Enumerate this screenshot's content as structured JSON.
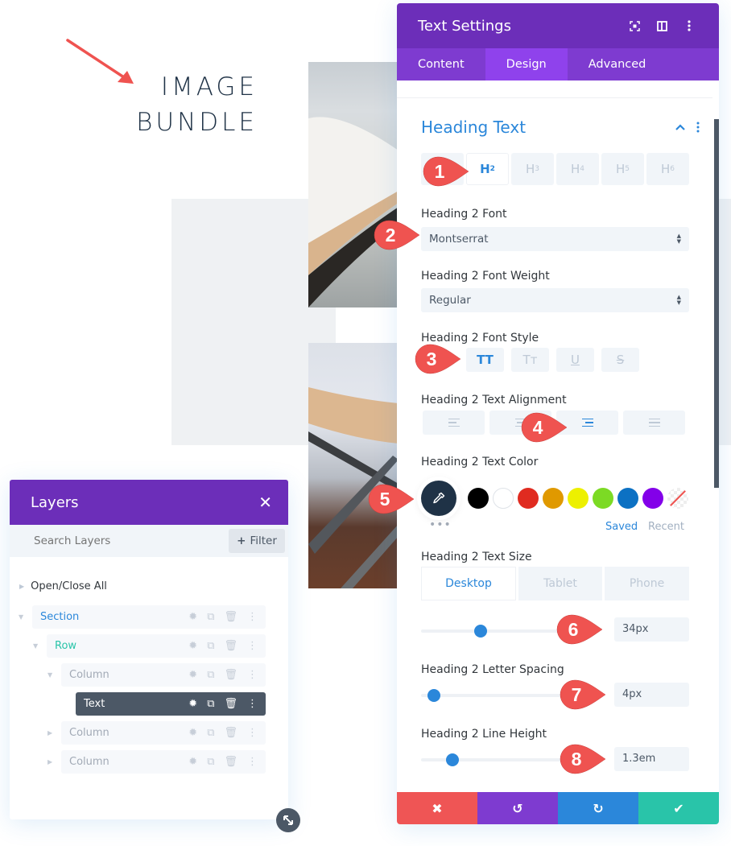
{
  "canvas": {
    "heading_line1": "IMAGE",
    "heading_line2": "BUNDLE"
  },
  "markers": [
    "1",
    "2",
    "3",
    "4",
    "5",
    "6",
    "7",
    "8"
  ],
  "settings": {
    "title": "Text Settings",
    "header_icons": [
      "fullscreen-icon",
      "split-view-icon",
      "more-vertical-icon"
    ],
    "tabs": [
      {
        "label": "Content",
        "active": false
      },
      {
        "label": "Design",
        "active": true
      },
      {
        "label": "Advanced",
        "active": false
      }
    ],
    "section_title": "Heading Text",
    "heading_tabs": [
      {
        "label": "H",
        "sub": "2",
        "active": true
      },
      {
        "label": "H",
        "sub": "3",
        "active": false
      },
      {
        "label": "H",
        "sub": "4",
        "active": false
      },
      {
        "label": "H",
        "sub": "5",
        "active": false
      },
      {
        "label": "H",
        "sub": "6",
        "active": false
      }
    ],
    "font": {
      "label": "Heading 2 Font",
      "value": "Montserrat"
    },
    "font_weight": {
      "label": "Heading 2 Font Weight",
      "value": "Regular"
    },
    "font_style": {
      "label": "Heading 2 Font Style",
      "buttons": [
        {
          "label": "TT",
          "name": "uppercase",
          "active": true
        },
        {
          "label": "Tт",
          "name": "capitalize",
          "active": false
        },
        {
          "label": "U",
          "name": "underline",
          "active": false
        },
        {
          "label": "S",
          "name": "strikethrough",
          "active": false
        }
      ]
    },
    "text_alignment": {
      "label": "Heading 2 Text Alignment",
      "options": [
        "left",
        "center",
        "right",
        "justify"
      ],
      "selected": "right"
    },
    "text_color": {
      "label": "Heading 2 Text Color",
      "current": "#1f3246",
      "swatches": [
        "#000000",
        "#ffffff",
        "#e02b20",
        "#e09900",
        "#edf000",
        "#7cda24",
        "#0c71c3",
        "#8300e9",
        "transparent"
      ],
      "saved_label": "Saved",
      "recent_label": "Recent",
      "more_label": "•••"
    },
    "text_size": {
      "label": "Heading 2 Text Size",
      "devices": [
        {
          "label": "Desktop",
          "active": true
        },
        {
          "label": "Tablet",
          "active": false
        },
        {
          "label": "Phone",
          "active": false
        }
      ],
      "value": "34px",
      "slider_percent": 42
    },
    "letter_spacing": {
      "label": "Heading 2 Letter Spacing",
      "value": "4px",
      "slider_percent": 9
    },
    "line_height": {
      "label": "Heading 2 Line Height",
      "value": "1.3em",
      "slider_percent": 22
    },
    "footer": {
      "cancel_icon": "✖",
      "undo_icon": "↺",
      "redo_icon": "↻",
      "save_icon": "✔"
    },
    "colors": {
      "header": "#6c2eb9",
      "tabs": "#7e3bd0",
      "active_tab": "#8f42ec",
      "accent": "#2b87da",
      "cancel": "#ef5555",
      "undo": "#7e3bd0",
      "redo": "#2b87da",
      "save": "#29c4a9"
    }
  },
  "layers": {
    "title": "Layers",
    "search_placeholder": "Search Layers",
    "filter_label": "Filter",
    "open_close_label": "Open/Close All",
    "items": [
      {
        "label": "Section",
        "type": "section",
        "color": "#2b87da"
      },
      {
        "label": "Row",
        "type": "row",
        "color": "#29c4a9"
      },
      {
        "label": "Column",
        "type": "column",
        "color": "#a2aab6"
      },
      {
        "label": "Text",
        "type": "module",
        "color": "#ffffff",
        "selected": true
      },
      {
        "label": "Column",
        "type": "column",
        "color": "#a2aab6"
      },
      {
        "label": "Column",
        "type": "column",
        "color": "#a2aab6"
      }
    ]
  }
}
